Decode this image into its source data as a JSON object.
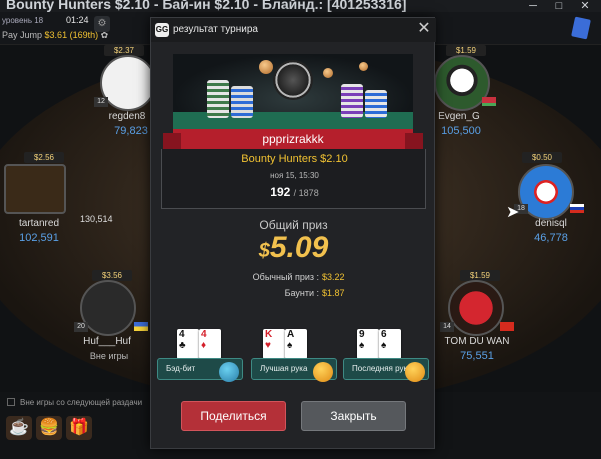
{
  "window": {
    "title": "Bounty Hunters $2.10 - Бай-ин $2.10 - Блайнд.: [401253316]",
    "level_text": "уровень 18",
    "clock": "01:24",
    "levels_label": "Pay Jump",
    "levels_value": "$3.61 (169th)"
  },
  "seats": [
    {
      "name": "regden8",
      "chips": "79,823",
      "stack": "$2.37",
      "level": "12"
    },
    {
      "name": "Evgen_G",
      "chips": "105,500",
      "stack": "$1.59",
      "level": ""
    },
    {
      "name": "tartanred",
      "chips": "102,591",
      "stack": "$2.56",
      "level": ""
    },
    {
      "name": "denisql",
      "chips": "46,778",
      "stack": "$0.50",
      "level": "18"
    },
    {
      "name": "Huf___Huf",
      "chips": "Вне игры",
      "stack": "$3.56",
      "level": "20"
    },
    {
      "name": "TOM DU WAN",
      "chips": "75,551",
      "stack": "$1.59",
      "level": "14"
    }
  ],
  "pot": "130,514",
  "bottom": {
    "sit_out_text": "Вне игры со следующей раздачи"
  },
  "modal": {
    "title": "результат турнира",
    "close": "✕",
    "player": "ppprizrakkk",
    "tournament": "Bounty Hunters $2.10",
    "date": "ноя 15, 15:30",
    "place": "192",
    "total": "/ 1878",
    "prize_label": "Общий приз",
    "prize_currency": "$",
    "prize_value": "5.09",
    "regular_label": "Обычный приз :",
    "regular_value": "$3.22",
    "bounty_label": "Баунти :",
    "bounty_value": "$1.87",
    "hands": [
      {
        "label": "Бэд-бит",
        "cards": [
          {
            "r": "4",
            "s": "♣",
            "c": "blk"
          },
          {
            "r": "4",
            "s": "♦",
            "c": "red"
          }
        ]
      },
      {
        "label": "Лучшая рука",
        "cards": [
          {
            "r": "K",
            "s": "♥",
            "c": "red"
          },
          {
            "r": "A",
            "s": "♠",
            "c": "blk"
          }
        ]
      },
      {
        "label": "Последняя рука",
        "cards": [
          {
            "r": "9",
            "s": "♠",
            "c": "blk"
          },
          {
            "r": "6",
            "s": "♠",
            "c": "blk"
          }
        ]
      }
    ],
    "share_label": "Поделиться",
    "close_label": "Закрыть"
  }
}
